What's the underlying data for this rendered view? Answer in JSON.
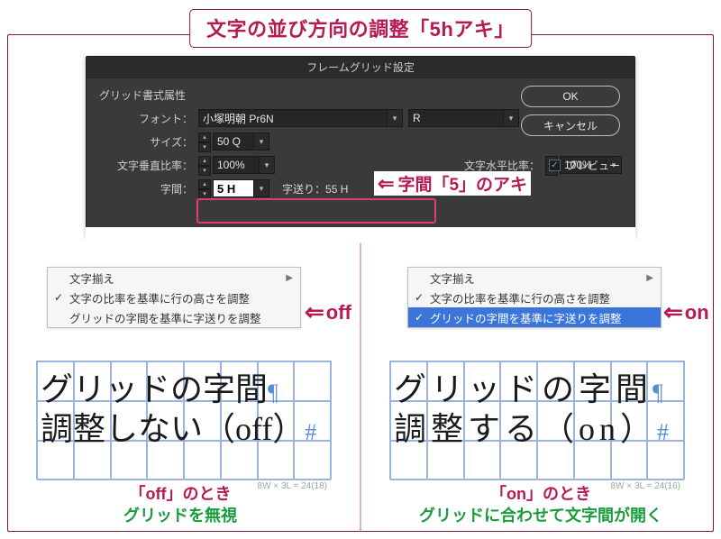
{
  "title": "文字の並び方向の調整「5hアキ」",
  "dialog": {
    "title": "フレームグリッド設定",
    "section": "グリッド書式属性",
    "font_label": "フォント：",
    "font_name": "小塚明朝 Pr6N",
    "font_weight": "R",
    "size_label": "サイズ：",
    "size_value": "50 Q",
    "vratio_label": "文字垂直比率：",
    "vratio_value": "100%",
    "hratio_label": "文字水平比率：",
    "hratio_value": "100%",
    "jikan_label": "字間：",
    "jikan_value": "5 H",
    "jiokuri_label": "字送り：",
    "jiokuri_value": "55 H",
    "ok": "OK",
    "cancel": "キャンセル",
    "preview": "プレビュー"
  },
  "jikan_callout": "字間「5」のアキ",
  "menu": {
    "item1": "文字揃え",
    "item2": "文字の比率を基準に行の高さを調整",
    "item3": "グリッドの字間を基準に字送りを調整"
  },
  "off_label": "off",
  "on_label": "on",
  "sample_left": {
    "line1": "グリッドの字間",
    "line2": "調整しない（off）",
    "grid_meta": "8W × 3L = 24(18)"
  },
  "sample_right": {
    "line1": "グリッドの字間",
    "line2": "調整する（on）",
    "grid_meta": "8W × 3L = 24(16)"
  },
  "caption_left": {
    "l1": "「off」のとき",
    "l2": "グリッドを無視"
  },
  "caption_right": {
    "l1": "「on」のとき",
    "l2": "グリッドに合わせて文字間が開く"
  }
}
